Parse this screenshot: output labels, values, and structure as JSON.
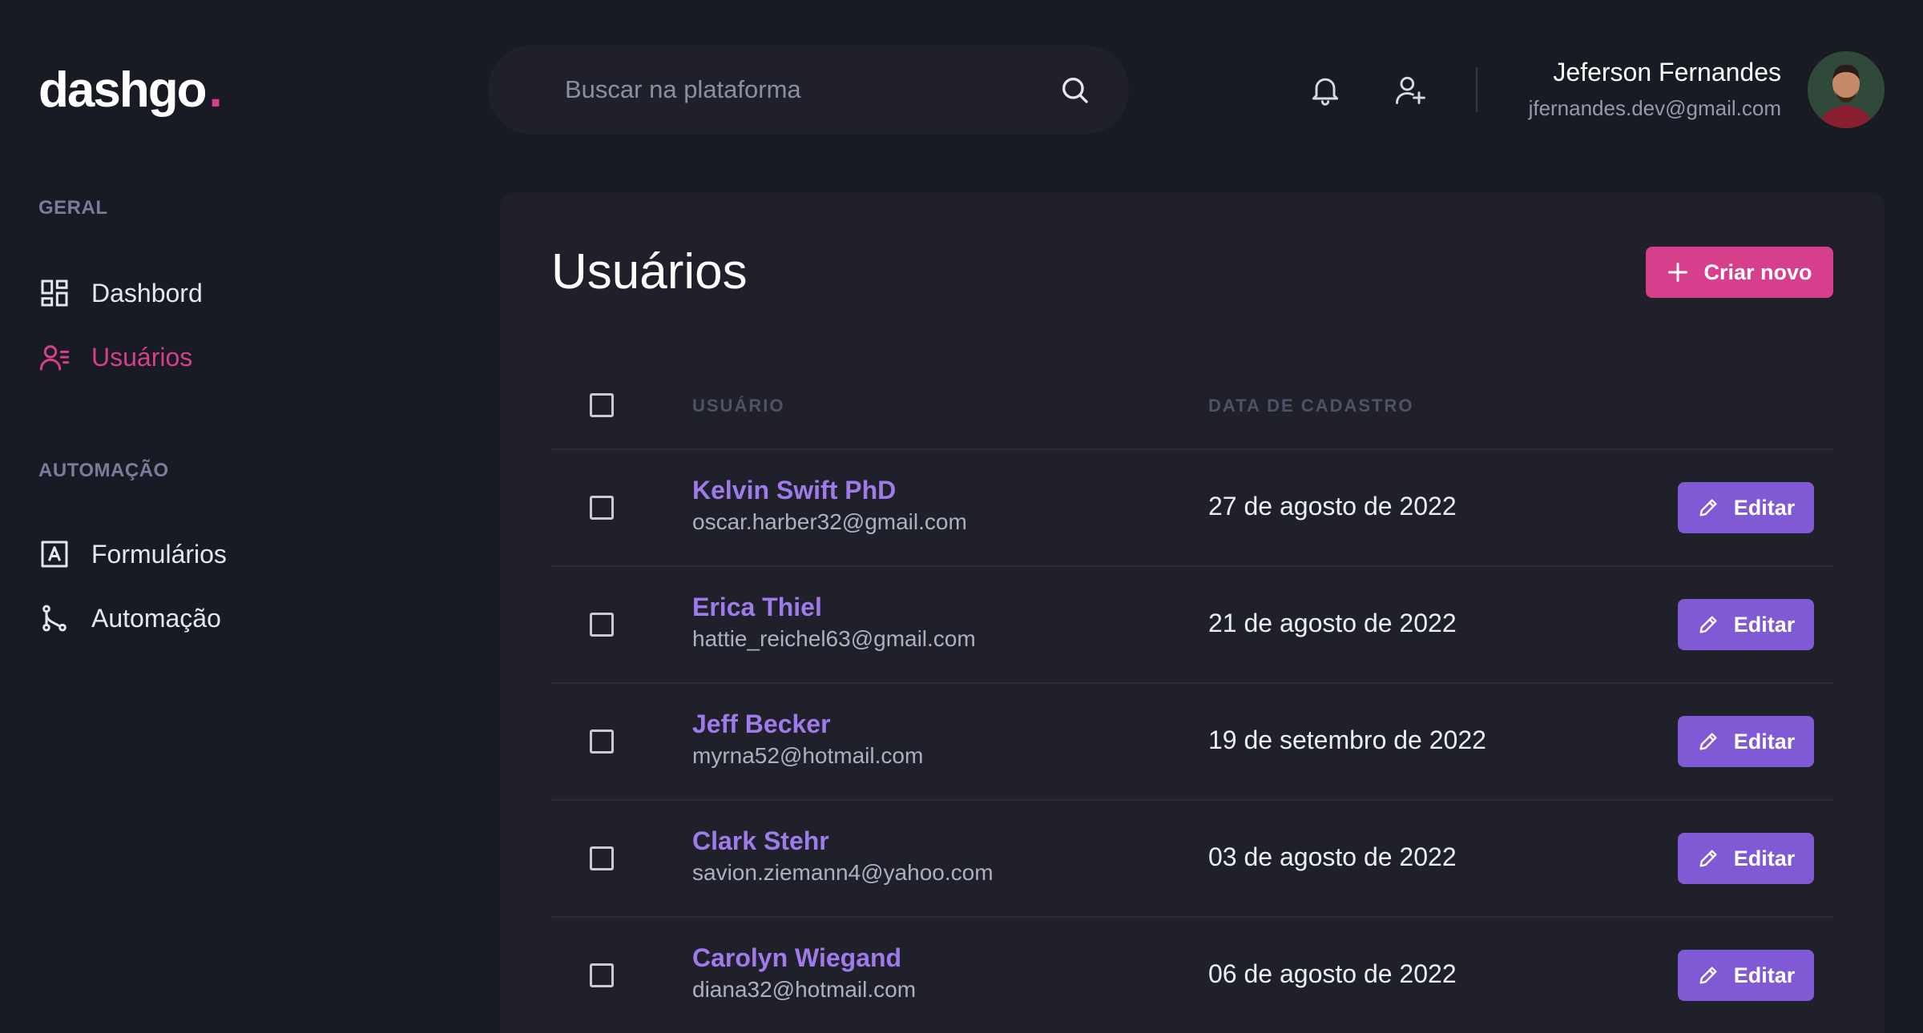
{
  "header": {
    "logo_text": "dashgo",
    "logo_dot": ".",
    "search_placeholder": "Buscar na plataforma",
    "user_name": "Jeferson Fernandes",
    "user_email": "jfernandes.dev@gmail.com"
  },
  "sidebar": {
    "sections": [
      {
        "title": "GERAL",
        "items": [
          {
            "label": "Dashbord",
            "icon": "dashboard-icon",
            "active": false
          },
          {
            "label": "Usuários",
            "icon": "users-icon",
            "active": true
          }
        ]
      },
      {
        "title": "AUTOMAÇÃO",
        "items": [
          {
            "label": "Formulários",
            "icon": "form-icon",
            "active": false
          },
          {
            "label": "Automação",
            "icon": "git-branch-icon",
            "active": false
          }
        ]
      }
    ]
  },
  "main": {
    "title": "Usuários",
    "new_button_label": "Criar novo",
    "table": {
      "columns": [
        "USUÁRIO",
        "DATA DE CADASTRO"
      ],
      "edit_label": "Editar",
      "rows": [
        {
          "name": "Kelvin Swift PhD",
          "email": "oscar.harber32@gmail.com",
          "date": "27 de agosto de 2022"
        },
        {
          "name": "Erica Thiel",
          "email": "hattie_reichel63@gmail.com",
          "date": "21 de agosto de 2022"
        },
        {
          "name": "Jeff Becker",
          "email": "myrna52@hotmail.com",
          "date": "19 de setembro de 2022"
        },
        {
          "name": "Clark Stehr",
          "email": "savion.ziemann4@yahoo.com",
          "date": "03 de agosto de 2022"
        },
        {
          "name": "Carolyn Wiegand",
          "email": "diana32@hotmail.com",
          "date": "06 de agosto de 2022"
        }
      ]
    }
  },
  "colors": {
    "background": "#181b23",
    "card": "#1f2029",
    "accent_pink": "#d53f8c",
    "accent_purple": "#805ad5",
    "user_name_purple": "#9f7aea"
  }
}
